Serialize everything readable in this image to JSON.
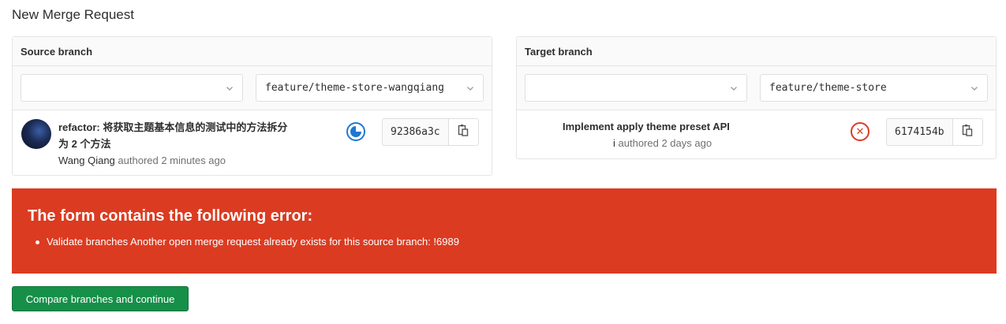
{
  "page": {
    "title": "New Merge Request"
  },
  "source": {
    "header": "Source branch",
    "project_select": {
      "value": ""
    },
    "branch_select": {
      "value": "feature/theme-store-wangqiang"
    },
    "commit": {
      "title_line1": "refactor: 将获取主题基本信息的测试中的方法拆分",
      "title_line2": "为 2 个方法",
      "author": "Wang Qiang",
      "authored_text": "authored 2 minutes ago",
      "pipeline_status": "running",
      "sha": "92386a3c"
    }
  },
  "target": {
    "header": "Target branch",
    "project_select": {
      "value": ""
    },
    "branch_select": {
      "value": "feature/theme-store"
    },
    "commit": {
      "title": "Implement apply theme preset API",
      "author_suffix": "i",
      "authored_text": "authored 2 days ago",
      "pipeline_status": "failed",
      "sha": "6174154b"
    }
  },
  "error": {
    "title": "The form contains the following error:",
    "items": [
      "Validate branches Another open merge request already exists for this source branch: !6989"
    ]
  },
  "actions": {
    "submit_label": "Compare branches and continue"
  },
  "colors": {
    "error_bg": "#db3b21",
    "submit_bg": "#168f48",
    "running": "#1f78d1",
    "failed": "#db3b21"
  },
  "icons": {
    "dropdown": "chevron-down-icon",
    "copy": "clipboard-icon",
    "running": "status-running-icon",
    "failed": "status-failed-icon"
  }
}
